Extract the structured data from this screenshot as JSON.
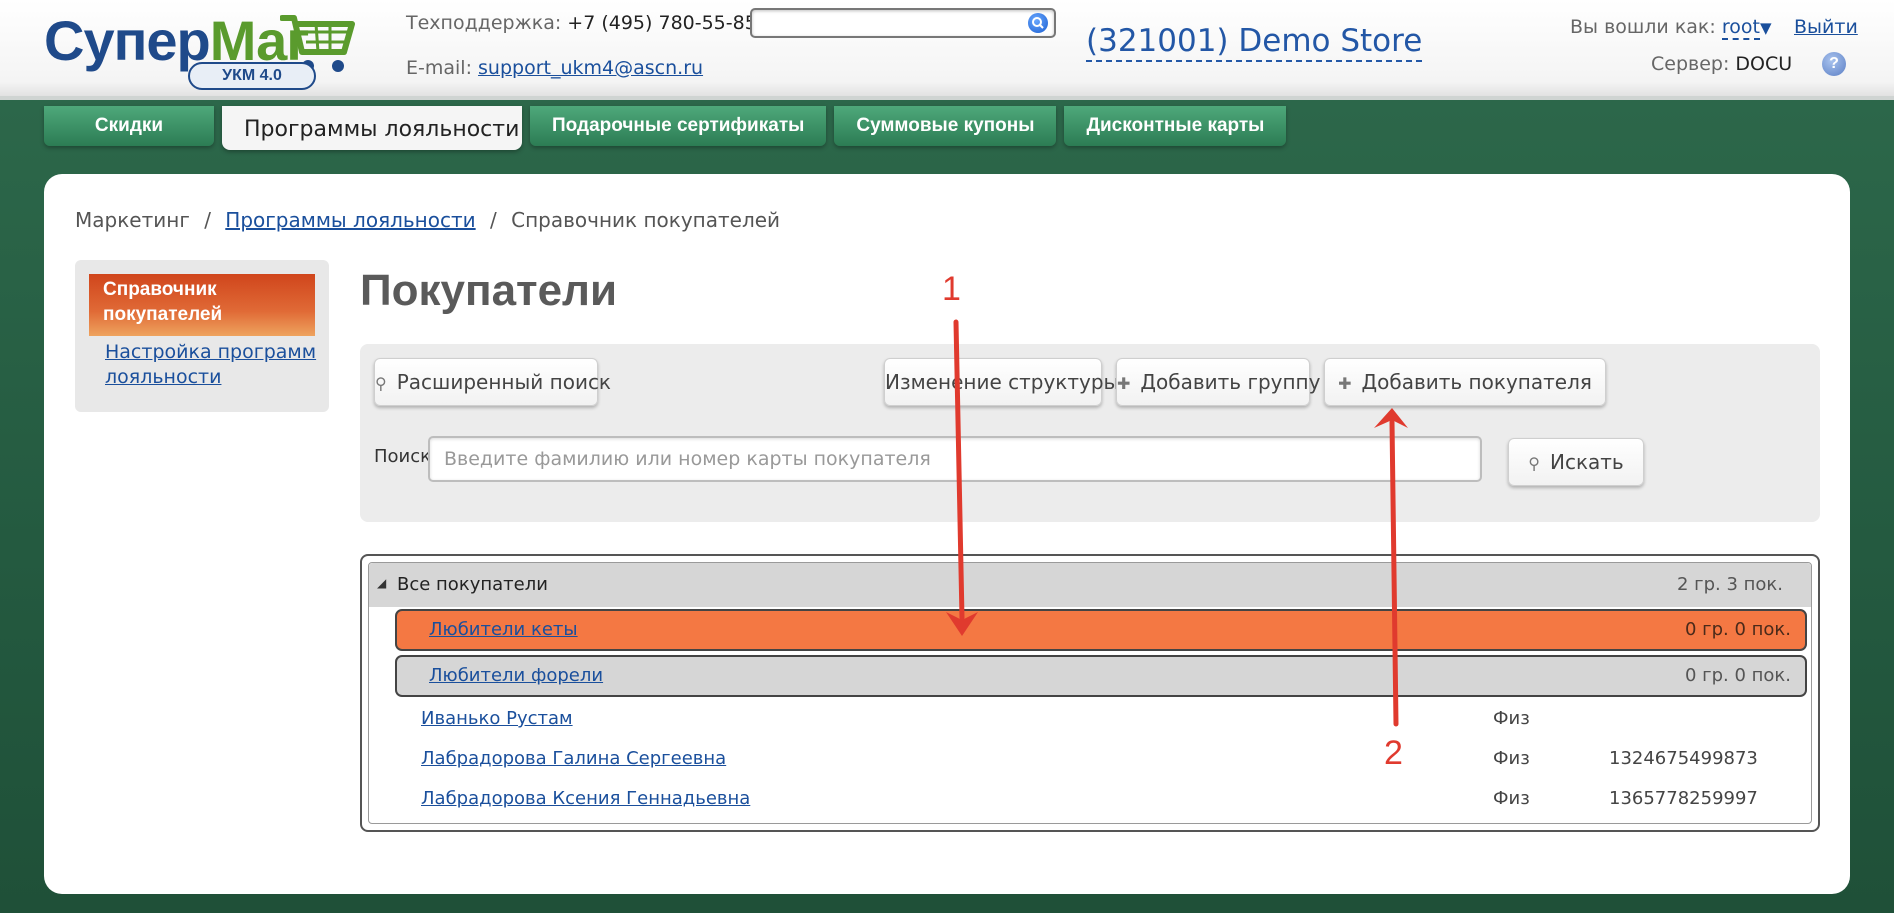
{
  "header": {
    "logo": {
      "part1": "Супер",
      "part2": "Маг",
      "badge": "УКМ 4.0"
    },
    "support": {
      "phone_label": "Техподдержка:",
      "phone": "+7 (495) 780-55-85",
      "email_label": "E-mail:",
      "email": "support_ukm4@ascn.ru"
    },
    "search": {
      "value": "",
      "placeholder": ""
    },
    "store": "(321001) Demo Store",
    "user": {
      "label": "Вы вошли как:",
      "name": "root",
      "dropdown_glyph": "▼"
    },
    "logout": "Выйти",
    "server": {
      "label": "Сервер:",
      "value": "DOCU"
    },
    "help_glyph": "?"
  },
  "tabs": [
    {
      "label": "Скидки",
      "active": false
    },
    {
      "label": "Программы лояльности",
      "active": true
    },
    {
      "label": "Подарочные сертификаты",
      "active": false
    },
    {
      "label": "Суммовые купоны",
      "active": false
    },
    {
      "label": "Дисконтные карты",
      "active": false
    }
  ],
  "breadcrumb": {
    "items": [
      "Маркетинг",
      "Программы лояльности",
      "Справочник покупателей"
    ],
    "separator": "/"
  },
  "sidebar": {
    "active": "Справочник покупателей",
    "link": "Настройка программ лояльности"
  },
  "main": {
    "title": "Покупатели",
    "toolbar": {
      "advanced_search": "Расширенный поиск",
      "change_structure": "Изменение структуры",
      "add_group": "Добавить группу",
      "add_customer": "Добавить покупателя",
      "plus_glyph": "✚",
      "search_glyph": "⚲"
    },
    "search": {
      "label": "Поиск:",
      "placeholder": "Введите фамилию или номер карты покупателя",
      "value": "",
      "button": "Искать"
    }
  },
  "tree": {
    "root": {
      "toggle_glyph": "◢",
      "name": "Все покупатели",
      "count": "2 гр. 3 пок."
    },
    "groups": [
      {
        "name": "Любители кеты",
        "count": "0 гр. 0 пок.",
        "selected": true
      },
      {
        "name": "Любители форели",
        "count": "0 гр. 0 пок.",
        "selected": false
      }
    ],
    "customers": [
      {
        "name": "Иванько Рустам",
        "type": "Физ",
        "card": ""
      },
      {
        "name": "Лабрадорова Галина Сергеевна",
        "type": "Физ",
        "card": "1324675499873"
      },
      {
        "name": "Лабрадорова Ксения Геннадьевна",
        "type": "Физ",
        "card": "1365778259997"
      }
    ]
  },
  "annotations": {
    "marker1": "1",
    "marker2": "2",
    "color": "#e03a2e"
  },
  "colors": {
    "background": "#2e6a4c",
    "tab_green": "#3c9468",
    "selected_group": "#f47843",
    "sidebar_active": "#d0451c",
    "link": "#1a4f9c",
    "store_blue": "#2357a6"
  }
}
